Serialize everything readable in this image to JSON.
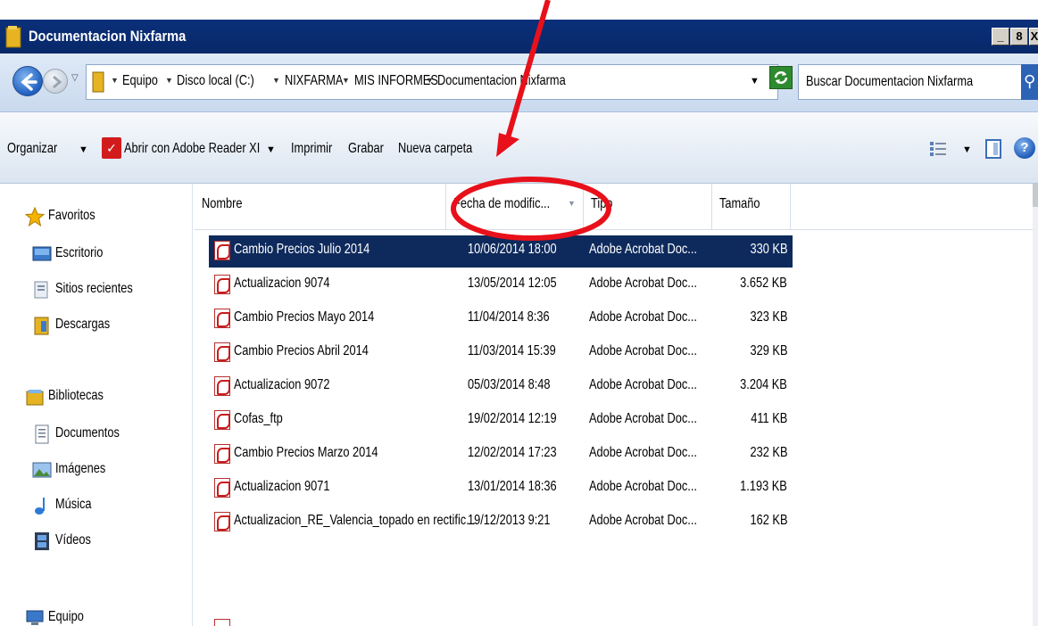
{
  "window": {
    "title": "Documentacion Nixfarma",
    "controls": [
      "_",
      "8",
      "X"
    ]
  },
  "address_bar": {
    "breadcrumbs": [
      "Equipo",
      "Disco local (C:)",
      "NIXFARMA",
      "MIS INFORMES",
      "Documentacion Nixfarma"
    ],
    "search_placeholder": "Buscar Documentacion Nixfarma"
  },
  "command_bar": {
    "organize": "Organizar",
    "open_with": "Abrir con Adobe Reader XI",
    "print": "Imprimir",
    "burn": "Grabar",
    "new_folder": "Nueva carpeta",
    "help_glyph": "?"
  },
  "nav_pane": {
    "favorites": {
      "label": "Favoritos",
      "icon": "star-icon"
    },
    "favorite_items": [
      {
        "label": "Escritorio",
        "icon": "desktop-icon"
      },
      {
        "label": "Sitios recientes",
        "icon": "recent-places-icon"
      },
      {
        "label": "Descargas",
        "icon": "downloads-icon"
      }
    ],
    "libraries": {
      "label": "Bibliotecas",
      "icon": "libraries-icon"
    },
    "library_items": [
      {
        "label": "Documentos",
        "icon": "documents-icon"
      },
      {
        "label": "Imágenes",
        "icon": "pictures-icon"
      },
      {
        "label": "Música",
        "icon": "music-icon"
      },
      {
        "label": "Vídeos",
        "icon": "videos-icon"
      }
    ],
    "computer": {
      "label": "Equipo",
      "icon": "computer-icon"
    }
  },
  "columns": {
    "name": "Nombre",
    "date": "Fecha de modific...",
    "type": "Tipo",
    "size": "Tamaño"
  },
  "files": [
    {
      "name": "Cambio Precios Julio 2014",
      "date": "10/06/2014 18:00",
      "type": "Adobe Acrobat Doc...",
      "size": "330 KB",
      "selected": true
    },
    {
      "name": "Actualizacion 9074",
      "date": "13/05/2014 12:05",
      "type": "Adobe Acrobat Doc...",
      "size": "3.652 KB"
    },
    {
      "name": "Cambio Precios Mayo 2014",
      "date": "11/04/2014 8:36",
      "type": "Adobe Acrobat Doc...",
      "size": "323 KB"
    },
    {
      "name": "Cambio Precios Abril 2014",
      "date": "11/03/2014 15:39",
      "type": "Adobe Acrobat Doc...",
      "size": "329 KB"
    },
    {
      "name": "Actualizacion 9072",
      "date": "05/03/2014 8:48",
      "type": "Adobe Acrobat Doc...",
      "size": "3.204 KB"
    },
    {
      "name": "Cofas_ftp",
      "date": "19/02/2014 12:19",
      "type": "Adobe Acrobat Doc...",
      "size": "411 KB"
    },
    {
      "name": "Cambio Precios Marzo 2014",
      "date": "12/02/2014 17:23",
      "type": "Adobe Acrobat Doc...",
      "size": "232 KB"
    },
    {
      "name": "Actualizacion 9071",
      "date": "13/01/2014 18:36",
      "type": "Adobe Acrobat Doc...",
      "size": "1.193 KB"
    },
    {
      "name": "Actualizacion_RE_Valencia_topado en rectific...",
      "date": "19/12/2013 9:21",
      "type": "Adobe Acrobat Doc...",
      "size": "162 KB"
    }
  ],
  "annotation": {
    "color": "#e8101a"
  },
  "colors": {
    "titlebar": "#0a2f7a",
    "selection": "#0e2a5c"
  }
}
